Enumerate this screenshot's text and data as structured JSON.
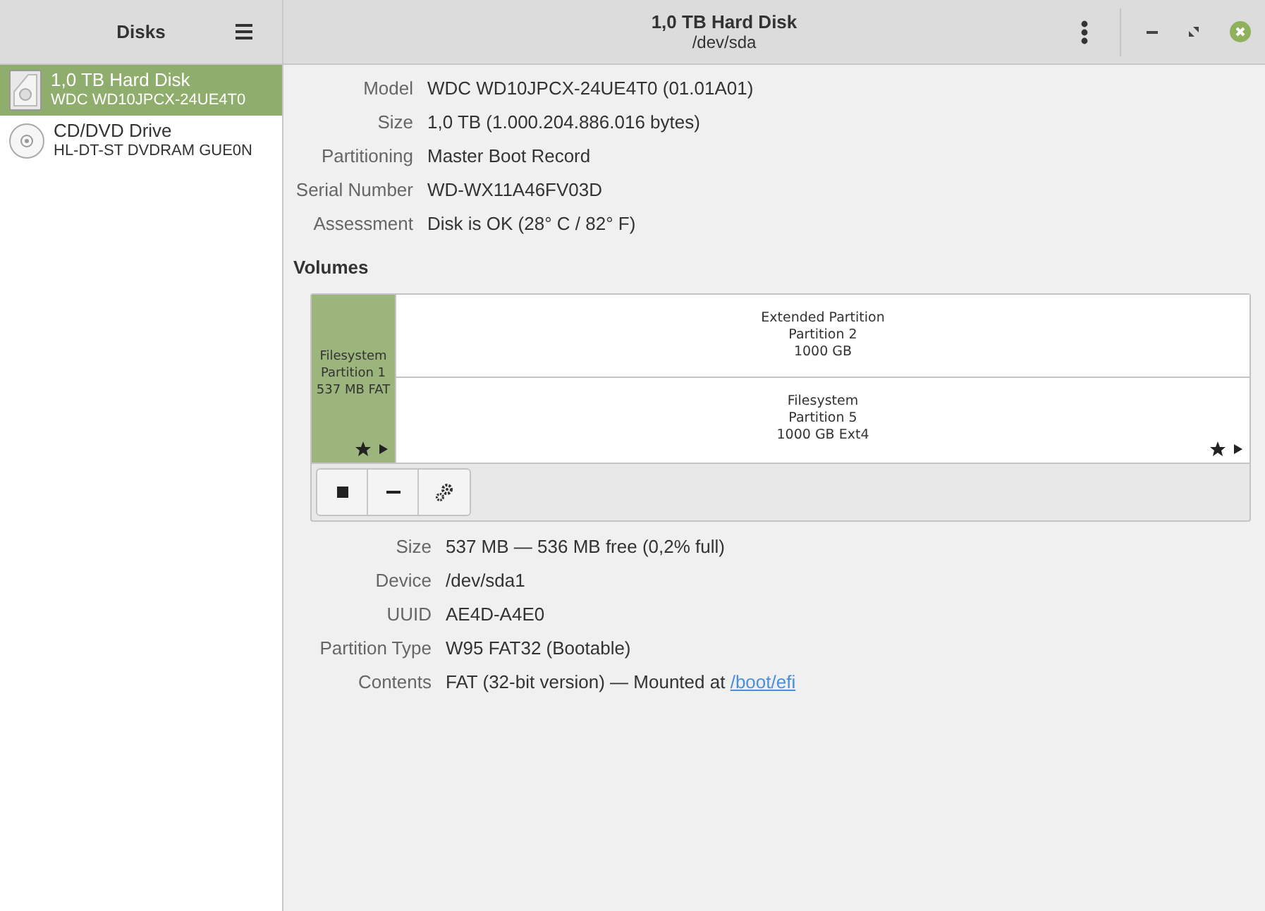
{
  "sidebar": {
    "title": "Disks",
    "devices": [
      {
        "kind": "hdd",
        "name": "1,0 TB Hard Disk",
        "model": "WDC WD10JPCX-24UE4T0",
        "selected": true
      },
      {
        "kind": "optical",
        "name": "CD/DVD Drive",
        "model": "HL-DT-ST DVDRAM GUE0N",
        "selected": false
      }
    ]
  },
  "window": {
    "title": "1,0 TB Hard Disk",
    "subtitle": "/dev/sda"
  },
  "disk_info": [
    {
      "label": "Model",
      "value": "WDC WD10JPCX-24UE4T0 (01.01A01)"
    },
    {
      "label": "Size",
      "value": "1,0 TB (1.000.204.886.016 bytes)"
    },
    {
      "label": "Partitioning",
      "value": "Master Boot Record"
    },
    {
      "label": "Serial Number",
      "value": "WD-WX11A46FV03D"
    },
    {
      "label": "Assessment",
      "value": "Disk is OK (28° C / 82° F)"
    }
  ],
  "volumes": {
    "heading": "Volumes",
    "partitions": [
      {
        "kind": "filesystem",
        "lines": [
          "Filesystem",
          "Partition 1",
          "537 MB FAT"
        ],
        "selected": true
      },
      {
        "kind": "extended",
        "lines": [
          "Extended Partition",
          "Partition 2",
          "1000 GB"
        ],
        "selected": false,
        "children": [
          {
            "kind": "filesystem",
            "lines": [
              "Filesystem",
              "Partition 5",
              "1000 GB Ext4"
            ],
            "selected": false
          }
        ]
      }
    ]
  },
  "volume_info": [
    {
      "label": "Size",
      "value": "537 MB — 536 MB free (0,2% full)"
    },
    {
      "label": "Device",
      "value": "/dev/sda1"
    },
    {
      "label": "UUID",
      "value": "AE4D-A4E0"
    },
    {
      "label": "Partition Type",
      "value": "W95 FAT32 (Bootable)"
    },
    {
      "label": "Contents",
      "value": "FAT (32-bit version) — Mounted at ",
      "link": "/boot/efi"
    }
  ]
}
